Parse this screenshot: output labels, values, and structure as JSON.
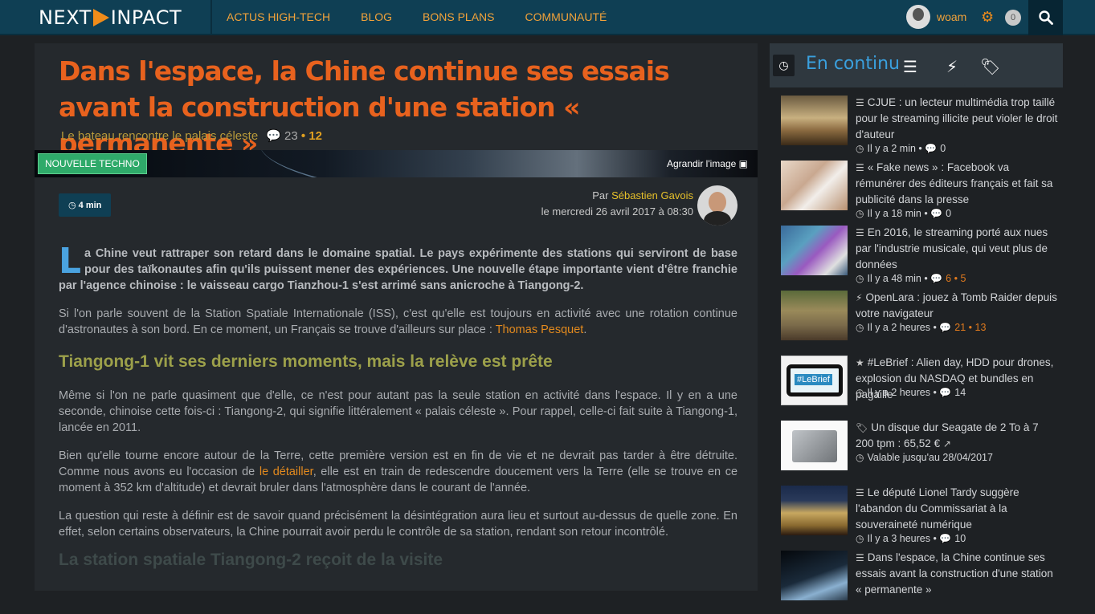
{
  "header": {
    "logo_left": "NEXT",
    "logo_right": "INPACT",
    "nav": [
      "ACTUS HIGH-TECH",
      "BLOG",
      "BONS PLANS",
      "COMMUNAUTÉ"
    ],
    "user_name": "woam",
    "notifications": "0"
  },
  "article": {
    "title": "Dans l'espace, la Chine continue ses essais avant la construction d'une station « permanente »",
    "subtitle": "Le bateau rencontre le palais céleste",
    "comments": "23",
    "hot_count": "12",
    "tag": "NOUVELLE TECHNO",
    "enlarge": "Agrandir l'image",
    "read_time": "4 min",
    "author_prefix": "Par",
    "author_name": "Sébastien Gavois",
    "date": "le mercredi 26 avril 2017 à 08:30",
    "lead_dropcap": "L",
    "lead": "a Chine veut rattraper son retard dans le domaine spatial. Le pays expérimente des stations qui serviront de base pour des taïkonautes afin qu'ils puissent mener des expériences. Une nouvelle étape importante vient d'être franchie par l'agence chinoise : le vaisseau cargo Tianzhou-1 s'est arrimé sans anicroche à Tiangong-2.",
    "p1_text": "Si l'on parle souvent de la Station Spatiale Internationale (ISS), c'est qu'elle est toujours en activité avec une rotation continue d'astronautes à son bord. En ce moment, un Français se trouve d'ailleurs sur place :",
    "p1_link": "Thomas Pesquet",
    "p1_end": ".",
    "h2": "Tiangong-1 vit ses derniers moments, mais la relève est prête",
    "p2": "Même si l'on ne parle quasiment que d'elle, ce n'est pour autant pas la seule station en activité dans l'espace. Il y en a une seconde, chinoise cette fois-ci : Tiangong-2, qui signifie littéralement « palais céleste ». Pour rappel, celle-ci fait suite à Tiangong-1, lancée en 2011.",
    "p3_a": "Bien qu'elle tourne encore autour de la Terre, cette première version est en fin de vie et ne devrait pas tarder à être détruite. Comme nous avons eu l'occasion de",
    "p3_link": "le détailler",
    "p3_b": ", elle est en train de redescendre doucement vers la Terre (elle se trouve en ce moment à 352 km d'altitude) et devrait bruler dans l'atmosphère dans le courant de l'année.",
    "p4": "La question qui reste à définir est de savoir quand précisément la désintégration aura lieu et surtout au-dessus de quelle zone. En effet, selon certains observateurs, la Chine pourrait avoir perdu le contrôle de sa station, rendant son retour incontrôlé.",
    "h2_cut": "La station spatiale Tiangong-2 reçoit de la visite"
  },
  "sidebar": {
    "title": "En continu",
    "items": [
      {
        "icon": "☰",
        "title": "CJUE : un lecteur multimédia trop taillé pour le streaming illicite peut violer le droit d'auteur",
        "time": "Il y a 2 min",
        "comments": "0",
        "hot": ""
      },
      {
        "icon": "☰",
        "title": "« Fake news » : Facebook va rémunérer des éditeurs français et fait sa publicité dans la presse",
        "time": "Il y a 18 min",
        "comments": "0",
        "hot": ""
      },
      {
        "icon": "☰",
        "title": "En 2016, le streaming porté aux nues par l'industrie musicale, qui veut plus de données",
        "time": "Il y a 48 min",
        "comments": "6",
        "hot": "5"
      },
      {
        "icon": "⚡",
        "title": "OpenLara : jouez à Tomb Raider depuis votre navigateur",
        "time": "Il y a 2 heures",
        "comments": "21",
        "hot": "13"
      },
      {
        "icon": "★",
        "title": "#LeBrief : Alien day, HDD pour drones, explosion du NASDAQ et bundles en pagaille",
        "time": "Il y a 2 heures",
        "comments": "14",
        "hot": ""
      },
      {
        "icon": "🏷",
        "title": "Un disque dur Seagate de 2 To à 7 200 tpm : 65,52 €",
        "time": "Valable jusqu'au 28/04/2017",
        "comments": "",
        "hot": ""
      },
      {
        "icon": "☰",
        "title": "Le député Lionel Tardy suggère l'abandon du Commissariat à la souveraineté numérique",
        "time": "Il y a 3 heures",
        "comments": "10",
        "hot": ""
      },
      {
        "icon": "☰",
        "title": "Dans l'espace, la Chine continue ses essais avant la construction d'une station « permanente »",
        "time": "",
        "comments": "",
        "hot": ""
      }
    ]
  },
  "colors": {
    "accent_orange": "#e8621e",
    "nav_orange": "#f2a23a",
    "link_blue": "#3aa0de",
    "topbar": "#0f3f54"
  }
}
